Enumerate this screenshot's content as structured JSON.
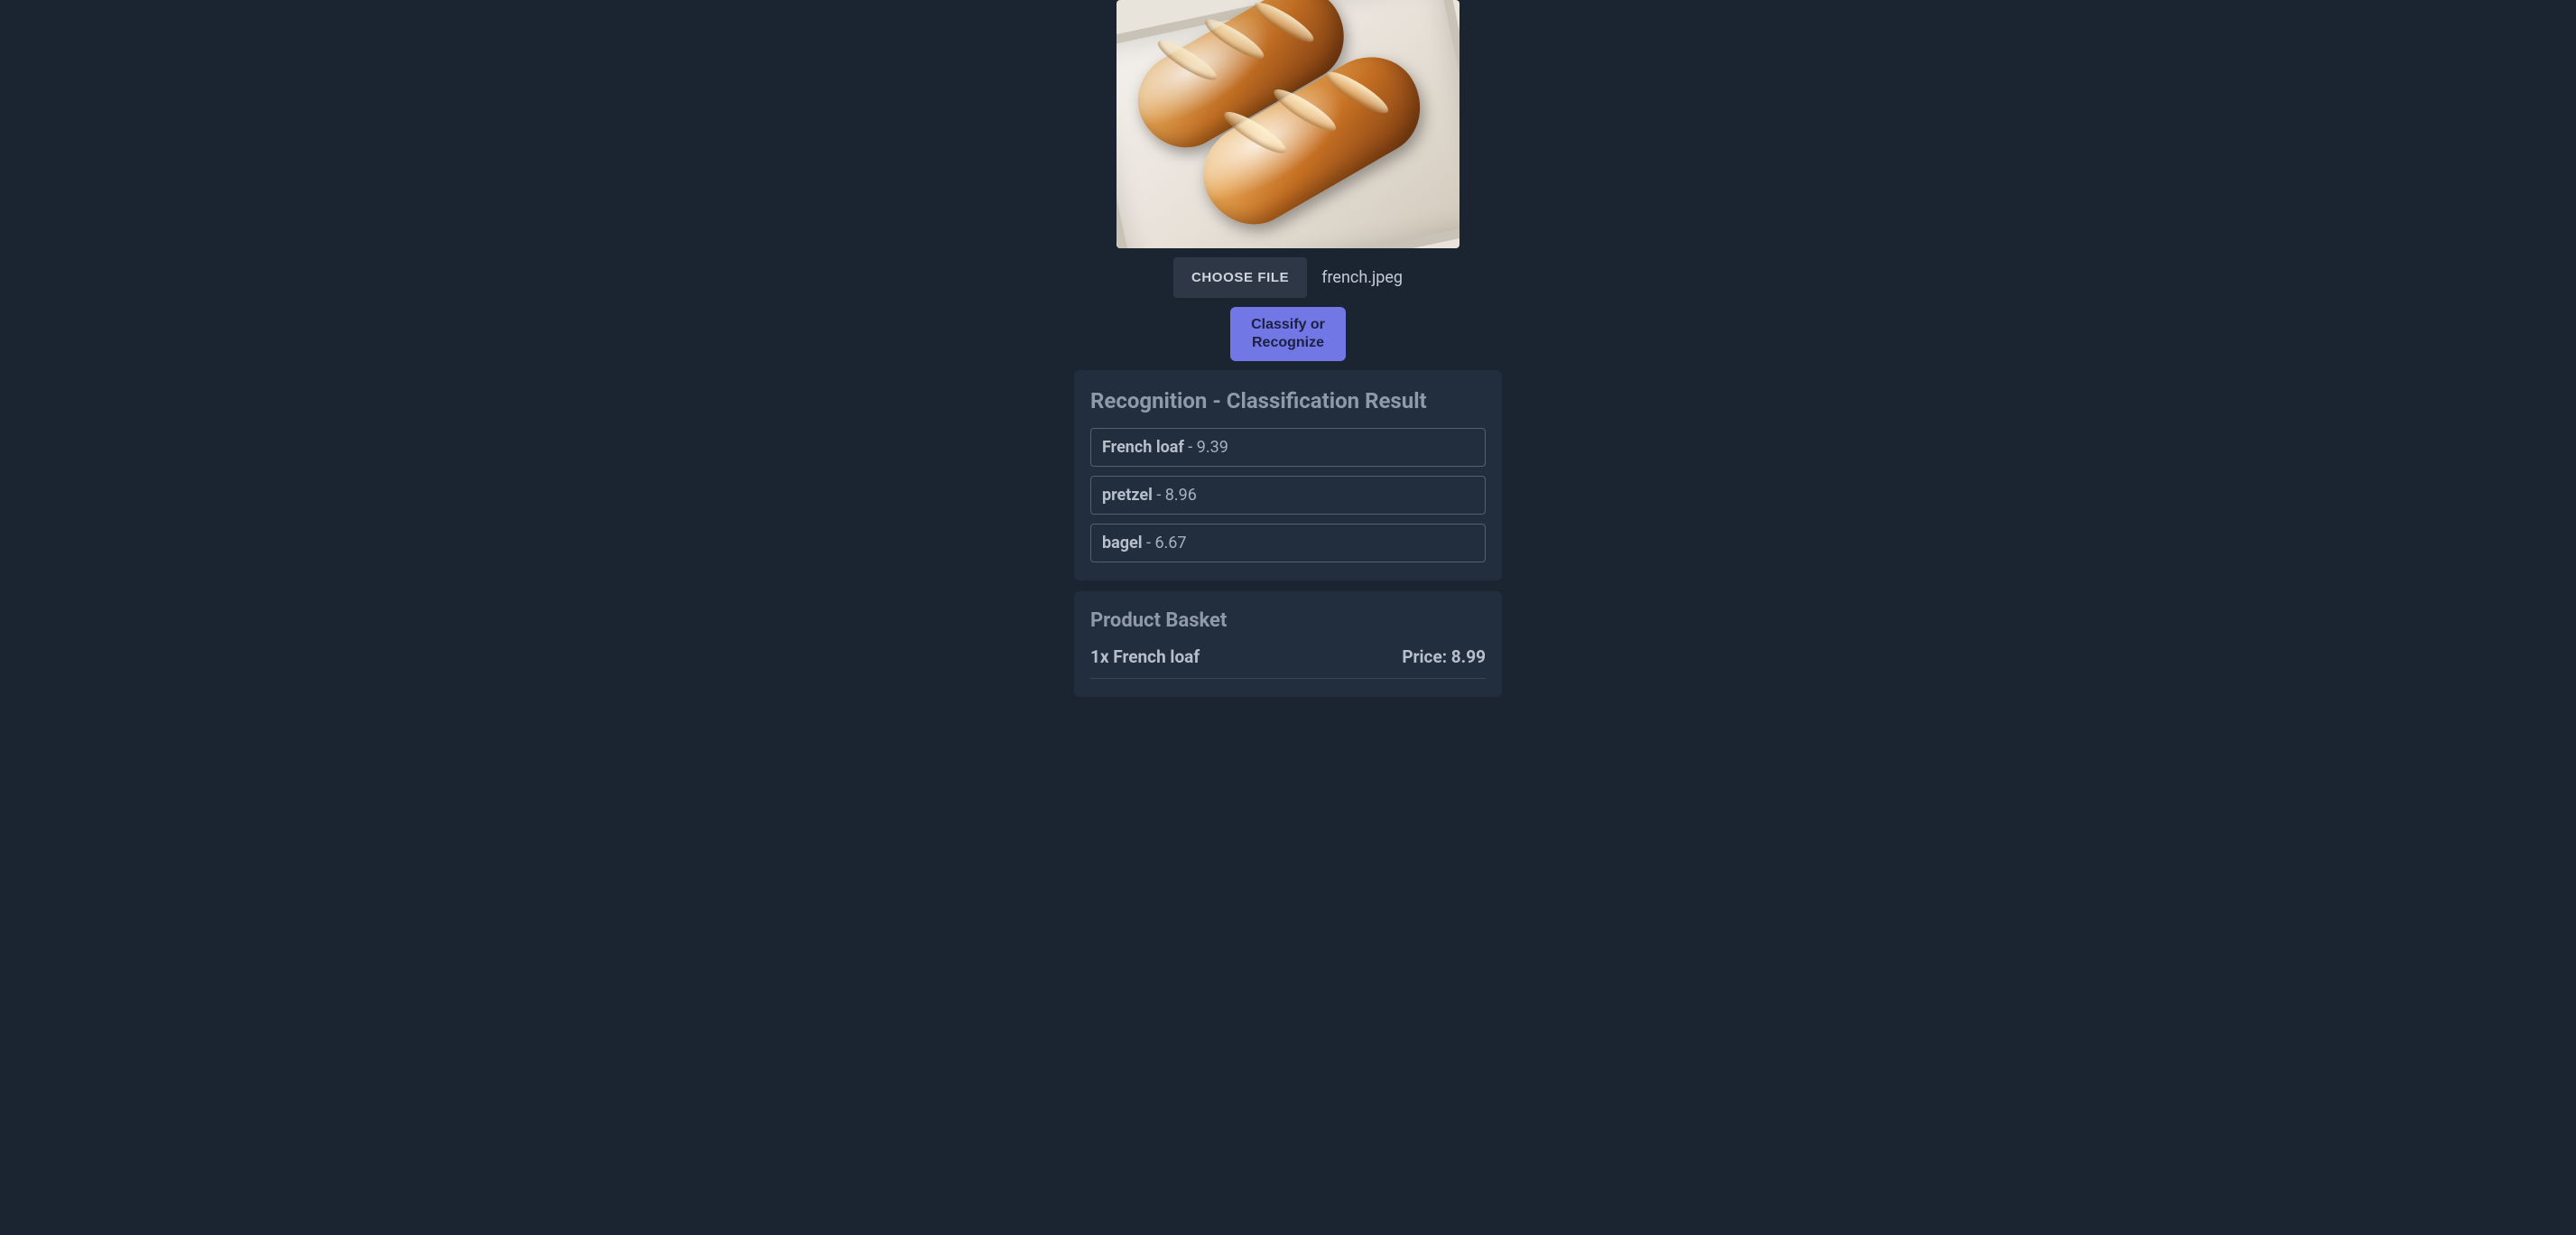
{
  "file": {
    "choose_label": "CHOOSE FILE",
    "filename": "french.jpeg"
  },
  "actions": {
    "classify_label": "Classify or Recognize"
  },
  "results": {
    "title": "Recognition - Classification Result",
    "items": [
      {
        "label": "French loaf",
        "separator": " - ",
        "score": "9.39"
      },
      {
        "label": "pretzel",
        "separator": " - ",
        "score": "8.96"
      },
      {
        "label": "bagel",
        "separator": " - ",
        "score": "6.67"
      }
    ]
  },
  "basket": {
    "title": "Product Basket",
    "items": [
      {
        "line": "1x French loaf",
        "price_label": "Price: 8.99"
      }
    ]
  }
}
